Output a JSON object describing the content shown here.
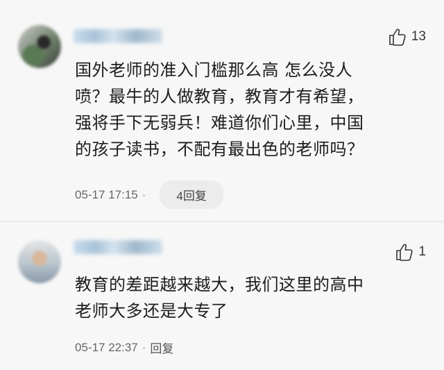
{
  "comments": [
    {
      "like_icon": "thumbs-up-icon",
      "like_count": "13",
      "content_lines": [
        "国外老师的准入门槛那么高 怎么没人",
        "喷？最牛的人做教育，教育才有希望，",
        "强将手下无弱兵！难道你们心里，中国",
        "的孩子读书，不配有最出色的老师吗？"
      ],
      "timestamp": "05-17 17:15",
      "separator": "·",
      "reply_label": "4回复"
    },
    {
      "like_icon": "thumbs-up-icon",
      "like_count": "1",
      "content_lines": [
        "教育的差距越来越大，我们这里的高中",
        "老师大多还是大专了"
      ],
      "timestamp": "05-17 22:37",
      "separator": "·",
      "reply_label": "回复"
    }
  ],
  "colors": {
    "background": "#f7f7f7",
    "text": "#1d1d1d",
    "meta_text": "#666666",
    "pill_background": "#ececec"
  }
}
